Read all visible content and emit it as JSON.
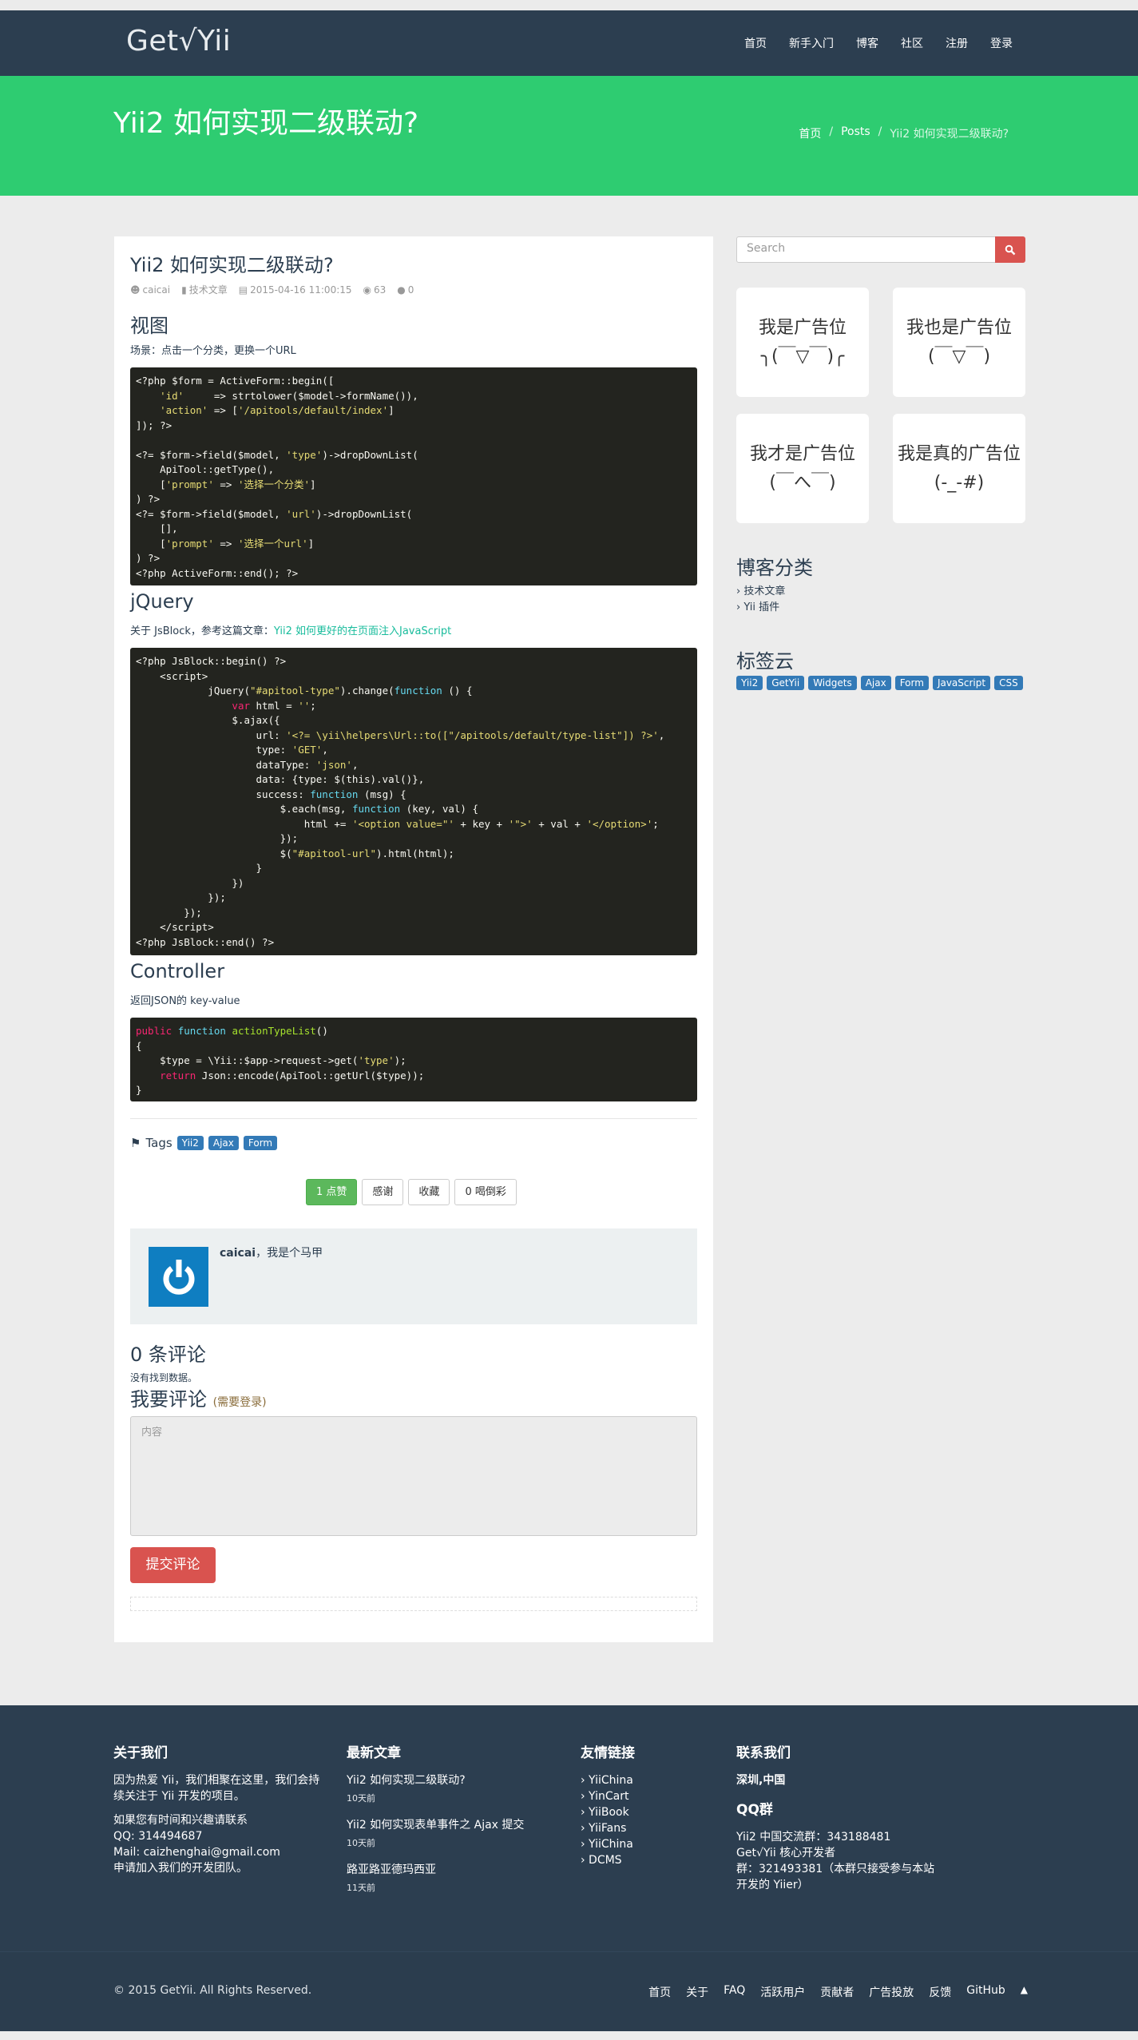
{
  "nav": {
    "brand": "Get√Yii",
    "links": [
      "首页",
      "新手入门",
      "博客",
      "社区",
      "注册",
      "登录"
    ]
  },
  "hero": {
    "title": "Yii2 如何实现二级联动?",
    "breadcrumb": [
      "首页",
      "Posts",
      "Yii2 如何实现二级联动?"
    ]
  },
  "post": {
    "title": "Yii2 如何实现二级联动?",
    "meta": {
      "author": "caicai",
      "category": "技术文章",
      "date": "2015-04-16 11:00:15",
      "views": "63",
      "comments": "0"
    },
    "section1": {
      "heading": "视图",
      "text": "场景：点击一个分类，更换一个URL"
    },
    "section2": {
      "heading": "jQuery",
      "text": "关于 JsBlock，参考这篇文章：",
      "link": "Yii2 如何更好的在页面注入JavaScript"
    },
    "section3": {
      "heading": "Controller",
      "text": "返回JSON的 key-value"
    },
    "tags_label": "Tags",
    "tags": [
      "Yii2",
      "Ajax",
      "Form"
    ],
    "buttons": {
      "like": "1 点赞",
      "thanks": "感谢",
      "favorite": "收藏",
      "cheer": "0 喝倒彩"
    },
    "author_box": {
      "name": "caicai",
      "bio": "，我是个马甲"
    },
    "comments_heading": "0 条评论",
    "no_data": "没有找到数据。",
    "comment_form": {
      "heading": "我要评论",
      "login_hint": "(需要登录)",
      "placeholder": "内容",
      "submit": "提交评论"
    }
  },
  "sidebar": {
    "search_placeholder": "Search",
    "ads": [
      {
        "title": "我是广告位",
        "face": "╮(￣▽￣)╭"
      },
      {
        "title": "我也是广告位",
        "face": "(￣▽￣)"
      },
      {
        "title": "我才是广告位",
        "face": "(￣へ￣)"
      },
      {
        "title": "我是真的广告位",
        "face": "(-_-#)"
      }
    ],
    "categories_heading": "博客分类",
    "categories": [
      "› 技术文章",
      "› Yii 插件"
    ],
    "tagcloud_heading": "标签云",
    "tagcloud": [
      "Yii2",
      "GetYii",
      "Widgets",
      "Ajax",
      "Form",
      "JavaScript",
      "CSS"
    ]
  },
  "footer": {
    "about": {
      "heading": "关于我们",
      "text1": "因为热爱 Yii，我们相聚在这里，我们会持续关注于 Yii 开发的项目。",
      "text2": "如果您有时间和兴趣请联系",
      "qq": "QQ:  314494687",
      "mail": "Mail:  caizhenghai@gmail.com",
      "join": "申请加入我们的开发团队。"
    },
    "latest": {
      "heading": "最新文章",
      "items": [
        {
          "title": "Yii2 如何实现二级联动?",
          "time": "10天前"
        },
        {
          "title": "Yii2 如何实现表单事件之 Ajax 提交",
          "time": "10天前"
        },
        {
          "title": "路亚路亚德玛西亚",
          "time": "11天前"
        }
      ]
    },
    "friends": {
      "heading": "友情链接",
      "items": [
        "› YiiChina",
        "› YinCart",
        "› YiiBook",
        "› YiiFans",
        "› YiiChina",
        "› DCMS"
      ]
    },
    "contact": {
      "heading": "联系我们",
      "location": "深圳,中国",
      "qq_heading": "QQ群",
      "group1": "Yii2 中国交流群：343188481",
      "group2": "Get√Yii 核心开发者",
      "group3": "群：321493381（本群只接受参与本站开发的 Yiier）"
    }
  },
  "bottom": {
    "copyright": "© 2015 GetYii. All Rights Reserved.",
    "links": [
      "首页",
      "关于",
      "FAQ",
      "活跃用户",
      "贡献者",
      "广告投放",
      "反馈",
      "GitHub"
    ]
  },
  "colors": {
    "navbar": "#2c3e50",
    "hero": "#2ecc71",
    "accent_red": "#d9534f",
    "label_blue": "#337ab7",
    "code_bg": "#23241f"
  }
}
